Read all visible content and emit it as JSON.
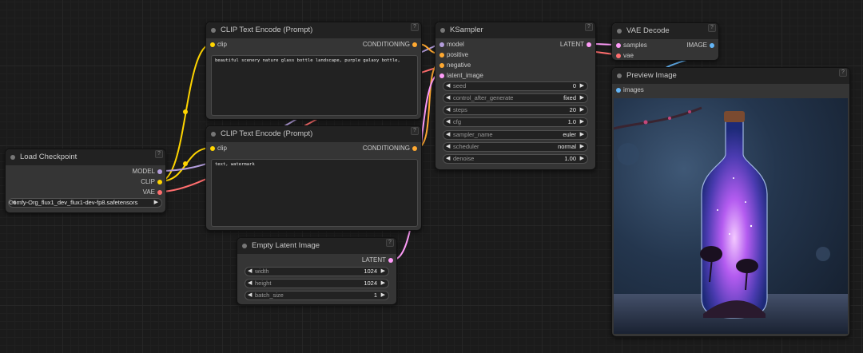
{
  "nodes": {
    "clip_pos": {
      "title": "CLIP Text Encode (Prompt)",
      "input": "clip",
      "output": "CONDITIONING",
      "text": "beautiful scenery nature glass bottle landscape, purple galaxy bottle,"
    },
    "clip_neg": {
      "title": "CLIP Text Encode (Prompt)",
      "input": "clip",
      "output": "CONDITIONING",
      "text": "text, watermark"
    },
    "checkpoint": {
      "title": "Load Checkpoint",
      "outputs": [
        "MODEL",
        "CLIP",
        "VAE"
      ],
      "ckpt_value": "Comfy-Org_flux1_dev_flux1-dev-fp8.safetensors"
    },
    "latent": {
      "title": "Empty Latent Image",
      "output": "LATENT",
      "widgets": [
        {
          "label": "width",
          "value": "1024"
        },
        {
          "label": "height",
          "value": "1024"
        },
        {
          "label": "batch_size",
          "value": "1"
        }
      ]
    },
    "ksampler": {
      "title": "KSampler",
      "inputs": [
        "model",
        "positive",
        "negative",
        "latent_image"
      ],
      "output": "LATENT",
      "widgets": [
        {
          "label": "seed",
          "value": "0"
        },
        {
          "label": "control_after_generate",
          "value": "fixed"
        },
        {
          "label": "steps",
          "value": "20"
        },
        {
          "label": "cfg",
          "value": "1.0"
        },
        {
          "label": "sampler_name",
          "value": "euler"
        },
        {
          "label": "scheduler",
          "value": "normal"
        },
        {
          "label": "denoise",
          "value": "1.00"
        }
      ]
    },
    "vae_decode": {
      "title": "VAE Decode",
      "inputs": [
        "samples",
        "vae"
      ],
      "output": "IMAGE"
    },
    "preview": {
      "title": "Preview Image",
      "input": "images"
    }
  },
  "help_glyph": "?",
  "arrow_left": "◀",
  "arrow_right": "▶",
  "colors": {
    "clip": "#ffd500",
    "model": "#b39ddb",
    "vae": "#ff6e6e",
    "conditioning": "#ffa931",
    "latent": "#ff9cf9",
    "image": "#64b5f6"
  }
}
